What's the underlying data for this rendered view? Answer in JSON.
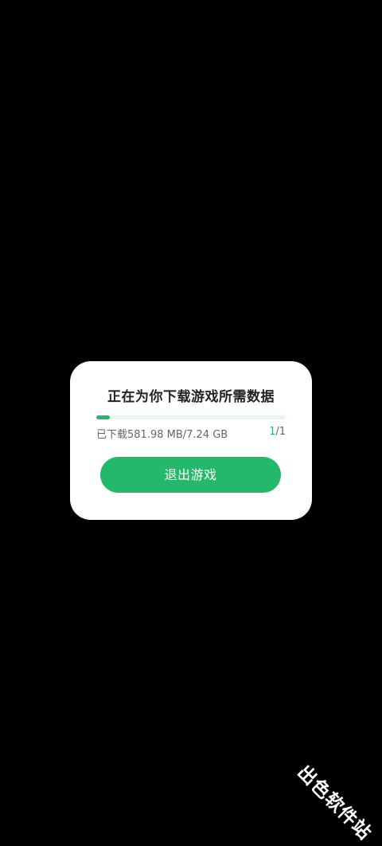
{
  "dialog": {
    "title": "正在为你下载游戏所需数据",
    "download_status": "已下载581.98 MB/7.24 GB",
    "progress_fraction": 0.07,
    "counter_current": "1",
    "counter_total": "/1",
    "exit_label": "退出游戏"
  },
  "watermark": {
    "text": "出色软件站"
  },
  "colors": {
    "accent": "#24b86a",
    "track": "#e9f6ef",
    "background": "#000000",
    "dialog": "#ffffff"
  }
}
